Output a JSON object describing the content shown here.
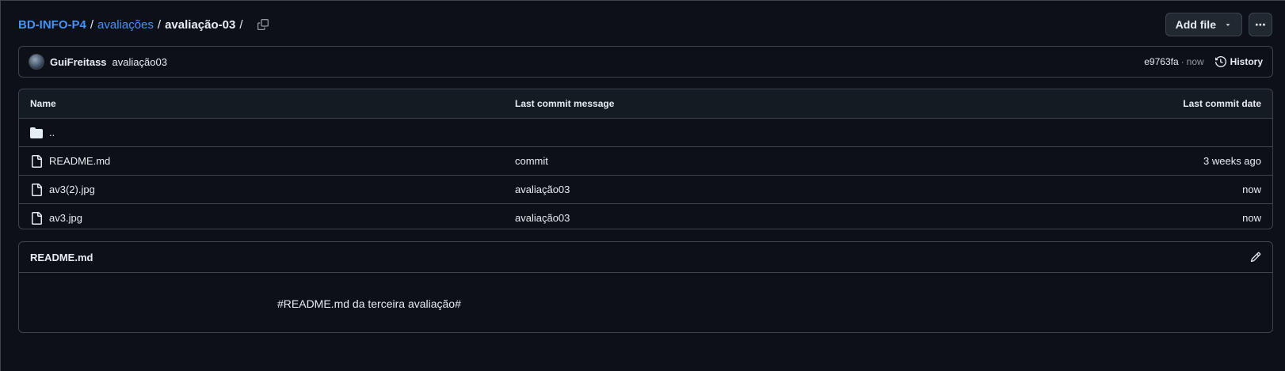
{
  "breadcrumb": {
    "repo": "BD-INFO-P4",
    "folder": "avaliações",
    "current": "avaliação-03",
    "sep": "/"
  },
  "toolbar": {
    "add_file_label": "Add file",
    "more_label": "⋯"
  },
  "commit": {
    "author": "GuiFreitass",
    "message": "avaliação03",
    "sha": "e9763fa",
    "dot": "·",
    "time": "now",
    "history_label": "History"
  },
  "table": {
    "headers": {
      "name": "Name",
      "message": "Last commit message",
      "date": "Last commit date"
    },
    "parent_dir": "..",
    "rows": [
      {
        "name": "README.md",
        "message": "commit",
        "date": "3 weeks ago"
      },
      {
        "name": "av3(2).jpg",
        "message": "avaliação03",
        "date": "now"
      },
      {
        "name": "av3.jpg",
        "message": "avaliação03",
        "date": "now"
      }
    ]
  },
  "readme": {
    "title": "README.md",
    "content": "#README.md da terceira avaliação#"
  },
  "icons": {
    "copy": "copy-icon",
    "caret": "triangle-down-icon",
    "history": "history-icon",
    "folder": "folder-icon",
    "file": "file-icon",
    "edit": "pencil-icon"
  },
  "colors": {
    "background": "#0d1117",
    "link": "#4493f8",
    "border": "#3d444d",
    "header_bg": "#151b23"
  }
}
